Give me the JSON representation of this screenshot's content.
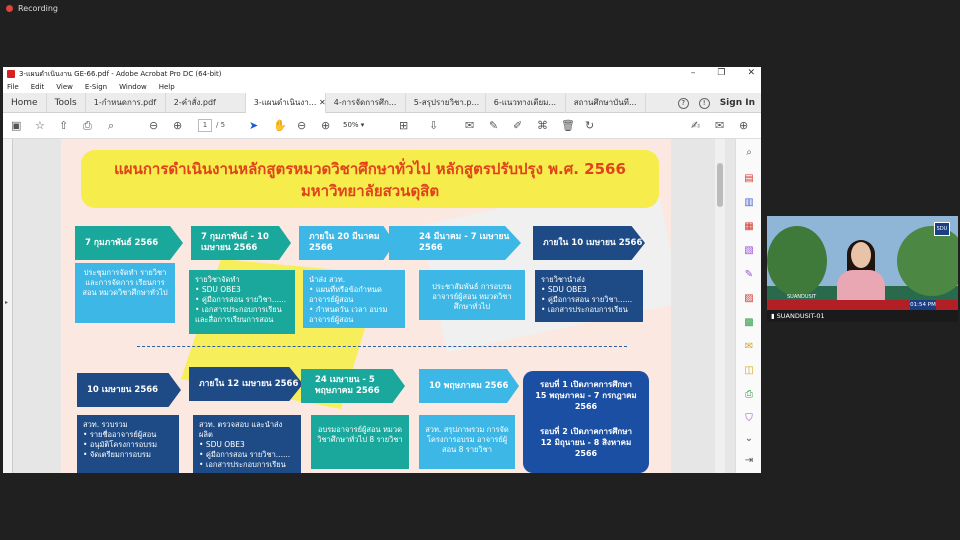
{
  "recording": {
    "label": "Recording"
  },
  "window": {
    "title": "3-แผนดำเนินงาน GE-66.pdf - Adobe Acrobat Pro DC (64-bit)",
    "menu": [
      "File",
      "Edit",
      "View",
      "E-Sign",
      "Window",
      "Help"
    ]
  },
  "tabs": {
    "home": "Home",
    "tools": "Tools",
    "docs": [
      "1-กำหนดการ.pdf",
      "2-คำสั่ง.pdf",
      "3-แผนดำเนินงา...",
      "4-การจัดการศึก...",
      "5-สรุปรายวิชา.p...",
      "6-แนวทางเตียม...",
      "สถานศึกษาบันที..."
    ],
    "signin": "Sign In"
  },
  "toolbar": {
    "page_current": "1",
    "page_total": "/ 5",
    "zoom": "50%"
  },
  "slide": {
    "title1": "แผนการดำเนินงานหลักสูตรหมวดวิชาศึกษาทั่วไป หลักสูตรปรับปรุง พ.ศ. 2566",
    "title2": "มหาวิทยาลัยสวนดุสิต",
    "row1": [
      {
        "date": "7 กุมภาพันธ์ 2566",
        "text": "ประชุมการจัดทำ รายวิชา และการจัดการ เรียนการสอน หมวดวิชาศึกษาทั่วไป"
      },
      {
        "date": "7 กุมภาพันธ์ - 10 เมษายน 2566",
        "lead": "รายวิชาจัดทำ",
        "items": [
          "SDU OBE3",
          "คู่มือการสอน รายวิชา......",
          "เอกสารประกอบการเรียน และสื่อการเรียนการสอน"
        ]
      },
      {
        "date": "ภายใน 20 มีนาคม 2566",
        "lead": "นำส่ง สวท.",
        "items": [
          "แผนที่หรือข้อกำหนด อาจารย์ผู้สอน",
          "กำหนดวัน เวลา อบรม อาจารย์ผู้สอน"
        ]
      },
      {
        "date": "24 มีนาคม - 7 เมษายน 2566",
        "text": "ประชาสัมพันธ์ การอบรมอาจารย์ผู้สอน หมวดวิชาศึกษาทั่วไป"
      },
      {
        "date": "ภายใน 10 เมษายน 2566",
        "lead": "รายวิชานำส่ง",
        "items": [
          "SDU OBE3",
          "คู่มือการสอน รายวิชา......",
          "เอกสารประกอบการเรียน"
        ]
      }
    ],
    "row2": [
      {
        "date": "10 เมษายน 2566",
        "lead": "สวท. รวบรวม",
        "items": [
          "รายชื่ออาจารย์ผู้สอน",
          "อนุมัติโครงการอบรม",
          "จัดเตรียมการอบรม"
        ]
      },
      {
        "date": "ภายใน 12 เมษายน 2566",
        "lead": "สวท. ตรวจสอบ และนำส่งผลิต",
        "items": [
          "SDU OBE3",
          "คู่มือการสอน รายวิชา......",
          "เอกสารประกอบการเรียน"
        ]
      },
      {
        "date": "24 เมษายน - 5 พฤษภาคม 2566",
        "text": "อบรมอาจารย์ผู้สอน หมวดวิชาศึกษาทั่วไป 8 รายวิชา"
      },
      {
        "date": "10 พฤษภาคม 2566",
        "text": "สวท. สรุปภาพรวม การจัดโครงการอบรม อาจารย์ผู้สอน 8 รายวิชา"
      }
    ],
    "rounds": [
      "รอบที่ 1 เปิดภาคการศึกษา",
      "15 พฤษภาคม - 7 กรกฎาคม",
      "2566",
      "รอบที่ 2 เปิดภาคการศึกษา",
      "12 มิถุนายน - 8 สิงหาคม",
      "2566"
    ]
  },
  "video": {
    "name": "SUANDUSIT-01",
    "time": "01:54 PM",
    "brand": "SUANDUSIT"
  },
  "colors": {
    "teal": "#1aa89c",
    "blue": "#1b4fa3",
    "cyan": "#3cb7e6",
    "navy": "#1e4b86",
    "yellow": "#f6ec4b",
    "title_red": "#e0431c"
  }
}
